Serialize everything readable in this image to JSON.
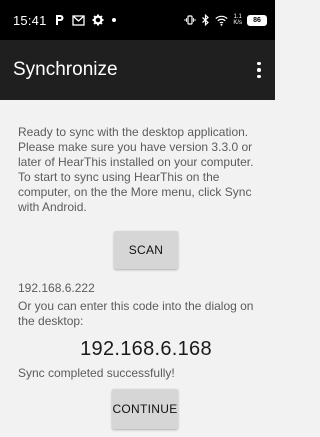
{
  "status_bar": {
    "time": "15:41",
    "left_icons": [
      "p-app-icon",
      "gmail-icon",
      "gear-icon",
      "dot-icon"
    ],
    "right_icons": [
      "vibrate-icon",
      "bluetooth-icon",
      "wifi-icon"
    ],
    "speed_top": "1.1",
    "speed_bottom": "K/s",
    "battery": "86"
  },
  "app_bar": {
    "title": "Synchronize",
    "overflow_icon": "more-vert-icon"
  },
  "main": {
    "intro": "Ready to sync with the desktop application. Please make sure you have version 3.3.0 or later of HearThis installed on your computer. To start to sync using HearThis on the computer, on the the More menu, click Sync with Android.",
    "scan_label": "SCAN",
    "scanned_ip": "192.168.6.222",
    "code_hint": "Or you can enter this code into the dialog on the desktop:",
    "code": "192.168.6.168",
    "status": "Sync completed successfully!",
    "continue_label": "CONTINUE"
  },
  "colors": {
    "status_bar": "#000000",
    "app_bar": "#1f1f1f",
    "background": "#f2f2f2",
    "button": "#d6d6d6",
    "body_text": "#5c5c5c"
  }
}
